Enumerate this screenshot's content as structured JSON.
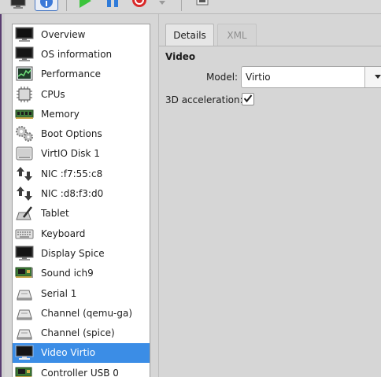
{
  "toolbar": {
    "icons": [
      "monitor-icon",
      "info-icon",
      "run-icon",
      "pause-icon",
      "shutdown-icon",
      "dropdown-arrow-icon",
      "screenshot-icon"
    ]
  },
  "sidebar": {
    "items": [
      {
        "label": "Overview",
        "icon": "monitor-icon"
      },
      {
        "label": "OS information",
        "icon": "os-monitor-icon"
      },
      {
        "label": "Performance",
        "icon": "performance-graph-icon"
      },
      {
        "label": "CPUs",
        "icon": "cpu-chip-icon"
      },
      {
        "label": "Memory",
        "icon": "memory-module-icon"
      },
      {
        "label": "Boot Options",
        "icon": "gears-icon"
      },
      {
        "label": "VirtIO Disk 1",
        "icon": "disk-drive-icon"
      },
      {
        "label": "NIC :f7:55:c8",
        "icon": "network-arrows-icon"
      },
      {
        "label": "NIC :d8:f3:d0",
        "icon": "network-arrows-icon"
      },
      {
        "label": "Tablet",
        "icon": "tablet-pen-icon"
      },
      {
        "label": "Keyboard",
        "icon": "keyboard-icon"
      },
      {
        "label": "Display Spice",
        "icon": "display-monitor-icon"
      },
      {
        "label": "Sound ich9",
        "icon": "sound-card-icon"
      },
      {
        "label": "Serial 1",
        "icon": "serial-device-icon"
      },
      {
        "label": "Channel (qemu-ga)",
        "icon": "channel-device-icon"
      },
      {
        "label": "Channel (spice)",
        "icon": "channel-device-icon"
      },
      {
        "label": "Video Virtio",
        "icon": "video-monitor-icon",
        "selected": true
      },
      {
        "label": "Controller USB 0",
        "icon": "controller-card-icon"
      }
    ]
  },
  "tabs": [
    {
      "label": "Details",
      "active": true
    },
    {
      "label": "XML",
      "active": false
    }
  ],
  "details": {
    "section_title": "Video",
    "model_label": "Model:",
    "model_value": "Virtio",
    "accel_label": "3D acceleration:",
    "accel_checked": true
  },
  "colors": {
    "selection": "#3b8de6",
    "run_green": "#3cc43c",
    "pause_blue": "#2f7bd9",
    "shutdown_red": "#d92a2a"
  }
}
